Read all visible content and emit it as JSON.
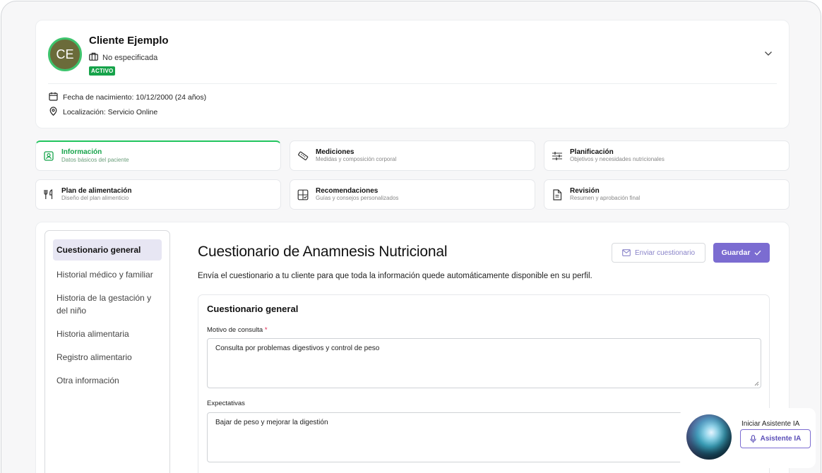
{
  "client": {
    "initials": "CE",
    "name": "Cliente Ejemplo",
    "company": "No especificada",
    "status": "ACTIVO",
    "birth": "Fecha de nacimiento: 10/12/2000 (24 años)",
    "location": "Localización: Servicio Online"
  },
  "tabs": [
    {
      "title": "Información",
      "subtitle": "Datos básicos del paciente",
      "icon": "user-card-icon",
      "active": true
    },
    {
      "title": "Mediciones",
      "subtitle": "Medidas y composición corporal",
      "icon": "ruler-icon",
      "active": false
    },
    {
      "title": "Planificación",
      "subtitle": "Objetivos y necesidades nutricionales",
      "icon": "sliders-icon",
      "active": false
    },
    {
      "title": "Plan de alimentación",
      "subtitle": "Diseño del plan alimenticio",
      "icon": "utensils-icon",
      "active": false
    },
    {
      "title": "Recomendaciones",
      "subtitle": "Guías y consejos personalizados",
      "icon": "grid-check-icon",
      "active": false
    },
    {
      "title": "Revisión",
      "subtitle": "Resumen y aprobación final",
      "icon": "document-icon",
      "active": false
    }
  ],
  "sidenav": [
    {
      "label": "Cuestionario general",
      "active": true
    },
    {
      "label": "Historial médico y familiar",
      "active": false
    },
    {
      "label": "Historia de la gestación y del niño",
      "active": false
    },
    {
      "label": "Historia alimentaria",
      "active": false
    },
    {
      "label": "Registro alimentario",
      "active": false
    },
    {
      "label": "Otra información",
      "active": false
    }
  ],
  "main": {
    "title": "Cuestionario de Anamnesis Nutricional",
    "description": "Envía el cuestionario a tu cliente para que toda la información quede automáticamente disponible en su perfil.",
    "send_label": "Enviar cuestionario",
    "save_label": "Guardar"
  },
  "form": {
    "title": "Cuestionario general",
    "reason_label": "Motivo de consulta",
    "required_mark": "*",
    "reason_value": "Consulta por problemas digestivos y control de peso",
    "expect_label": "Expectativas",
    "expect_value": "Bajar de peso y mejorar la digestión"
  },
  "assistant": {
    "caption": "Iniciar Asistente IA",
    "button_label": "Asistente IA"
  },
  "colors": {
    "accent": "#7b6cd1",
    "active_green": "#16a34a"
  }
}
